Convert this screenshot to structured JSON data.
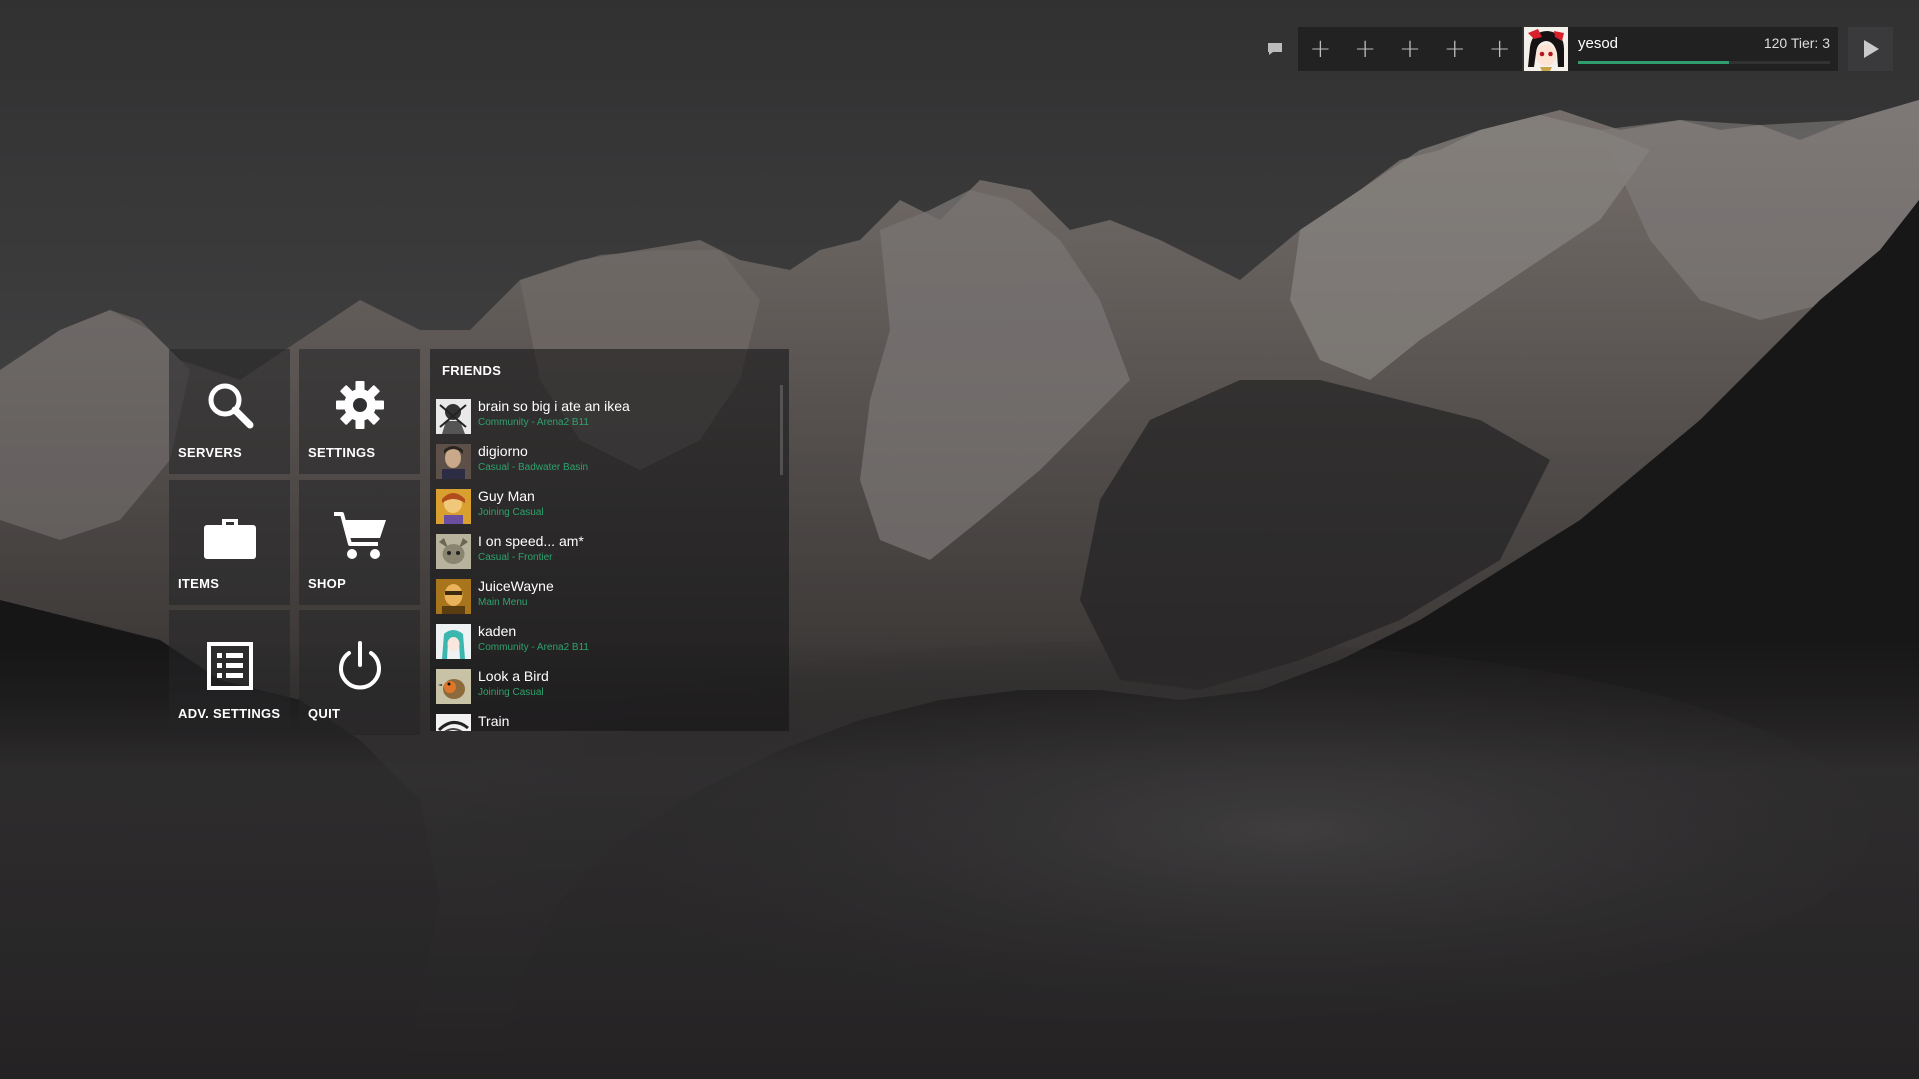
{
  "topbar": {
    "chat_icon": "chat-bubble-icon",
    "party_slots": [
      "+",
      "+",
      "+",
      "+",
      "+"
    ],
    "profile": {
      "name": "yesod",
      "level_text": "120 Tier: 3",
      "xp_progress": 0.6,
      "accent_color": "#2f9e6e"
    },
    "play_icon": "play-triangle-icon"
  },
  "menu": {
    "servers": {
      "label": "SERVERS",
      "icon": "search-icon"
    },
    "settings": {
      "label": "SETTINGS",
      "icon": "gear-icon"
    },
    "items": {
      "label": "ITEMS",
      "icon": "briefcase-icon"
    },
    "shop": {
      "label": "SHOP",
      "icon": "cart-icon"
    },
    "adv_settings": {
      "label": "ADV. SETTINGS",
      "icon": "list-icon"
    },
    "quit": {
      "label": "QUIT",
      "icon": "power-icon"
    }
  },
  "friends": {
    "title": "FRIENDS",
    "status_color": "#2ea36d",
    "list": [
      {
        "name": "brain so big i ate an ikea",
        "status": "Community - Arena2 B11"
      },
      {
        "name": "digiorno",
        "status": "Casual - Badwater Basin"
      },
      {
        "name": "Guy Man",
        "status": "Joining Casual"
      },
      {
        "name": "I on speed... am*",
        "status": "Casual - Frontier"
      },
      {
        "name": "JuiceWayne",
        "status": "Main Menu"
      },
      {
        "name": "kaden",
        "status": "Community - Arena2 B11"
      },
      {
        "name": "Look a Bird",
        "status": "Joining Casual"
      },
      {
        "name": "Train",
        "status": ""
      }
    ]
  }
}
